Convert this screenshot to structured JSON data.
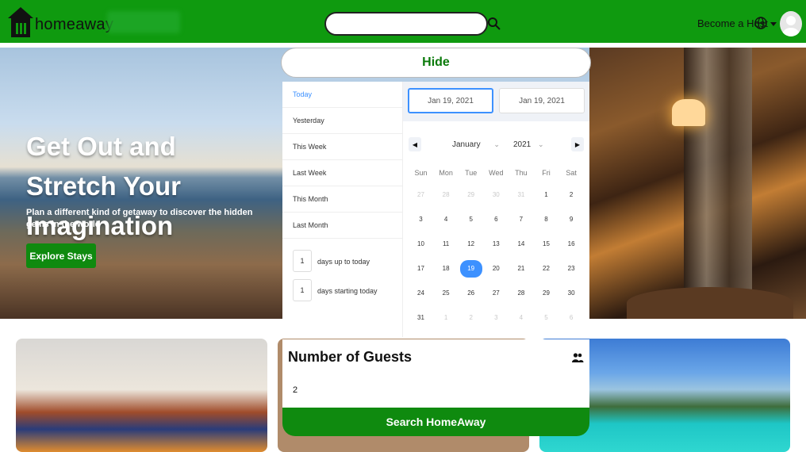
{
  "header": {
    "brand": "homeaway",
    "search_placeholder": "",
    "host_label": "Become a Host"
  },
  "hero": {
    "title": "Get Out and Stretch Your Imagination",
    "subtitle": "Plan a different kind of getaway to discover the hidden gems in the world",
    "cta_label": "Explore Stays"
  },
  "hide_label": "Hide",
  "ranges": {
    "items": [
      "Today",
      "Yesterday",
      "This Week",
      "Last Week",
      "This Month",
      "Last Month"
    ],
    "active_index": 0,
    "up_to_today": {
      "value": "1",
      "label": "days up to today"
    },
    "starting_today": {
      "value": "1",
      "label": "days starting today"
    }
  },
  "calendar": {
    "start_date": "Jan 19, 2021",
    "end_date": "Jan 19, 2021",
    "month": "January",
    "year": "2021",
    "weekdays": [
      "Sun",
      "Mon",
      "Tue",
      "Wed",
      "Thu",
      "Fri",
      "Sat"
    ],
    "days": [
      [
        "27",
        "28",
        "29",
        "30",
        "31",
        "1",
        "2"
      ],
      [
        "3",
        "4",
        "5",
        "6",
        "7",
        "8",
        "9"
      ],
      [
        "10",
        "11",
        "12",
        "13",
        "14",
        "15",
        "16"
      ],
      [
        "17",
        "18",
        "19",
        "20",
        "21",
        "22",
        "23"
      ],
      [
        "24",
        "25",
        "26",
        "27",
        "28",
        "29",
        "30"
      ],
      [
        "31",
        "1",
        "2",
        "3",
        "4",
        "5",
        "6"
      ]
    ],
    "selected_day": "19"
  },
  "guests": {
    "title": "Number of Guests",
    "value": "2",
    "search_label": "Search HomeAway"
  },
  "colors": {
    "brand_green": "#0f9a0f",
    "accent_blue": "#3d91ff"
  }
}
